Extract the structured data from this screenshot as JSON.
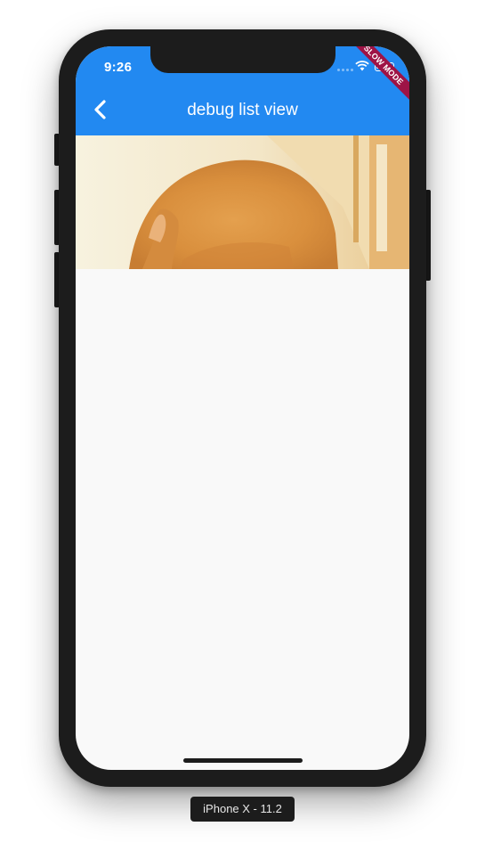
{
  "status_bar": {
    "time": "9:26"
  },
  "app_bar": {
    "title": "debug list view",
    "background_color": "#2289f1",
    "back_icon": "chevron-left-icon"
  },
  "debug_banner": {
    "label": "SLOW MODE",
    "color": "#9e1346"
  },
  "content": {
    "hero_image": "photo of a shiba inu dog"
  },
  "device": {
    "label": "iPhone X - 11.2"
  }
}
